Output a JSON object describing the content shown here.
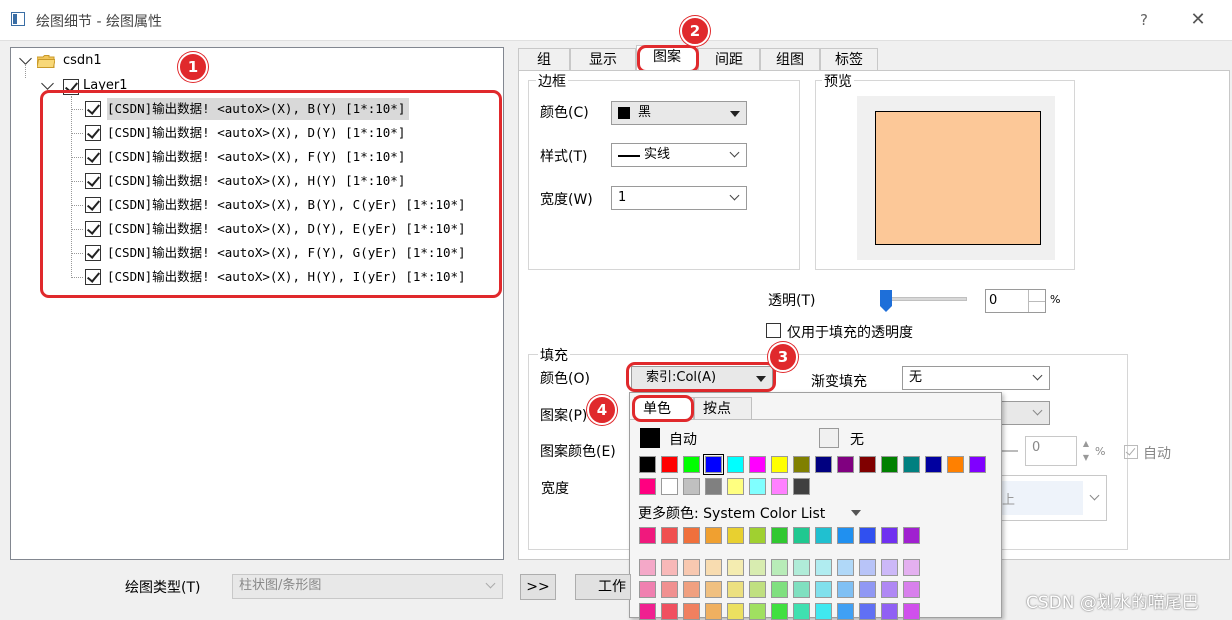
{
  "window": {
    "title": "绘图细节 - 绘图属性",
    "help_label": "?",
    "close_label": "✕"
  },
  "tree": {
    "root_label": "csdn1",
    "layer_label": "Layer1",
    "plots": [
      "[CSDN]输出数据! <autoX>(X), B(Y) [1*:10*]",
      "[CSDN]输出数据! <autoX>(X), D(Y) [1*:10*]",
      "[CSDN]输出数据! <autoX>(X), F(Y) [1*:10*]",
      "[CSDN]输出数据! <autoX>(X), H(Y) [1*:10*]",
      "[CSDN]输出数据! <autoX>(X), B(Y), C(yEr) [1*:10*]",
      "[CSDN]输出数据! <autoX>(X), D(Y), E(yEr) [1*:10*]",
      "[CSDN]输出数据! <autoX>(X), F(Y), G(yEr) [1*:10*]",
      "[CSDN]输出数据! <autoX>(X), H(Y), I(yEr) [1*:10*]"
    ]
  },
  "badges": [
    "1",
    "2",
    "3",
    "4"
  ],
  "tabs": [
    "组",
    "显示",
    "图案",
    "间距",
    "组图",
    "标签"
  ],
  "border_group": {
    "legend": "边框",
    "color_label": "颜色(C)",
    "color_value": "黑",
    "style_label": "样式(T)",
    "style_value": "实线",
    "width_label": "宽度(W)",
    "width_value": "1"
  },
  "preview": {
    "legend": "预览",
    "fill_color": "#fcc898"
  },
  "transparency": {
    "label": "透明(T)",
    "value": "0",
    "unit": "%",
    "fill_only_label": "仅用于填充的透明度"
  },
  "fill_group": {
    "legend": "填充",
    "color_label": "颜色(O)",
    "color_value": "索引:Col(A)",
    "gradient_label": "渐变填充",
    "gradient_value": "无",
    "pattern_label": "图案(P)",
    "pattern_color_label": "图案颜色(E)",
    "width_label": "宽度",
    "spin_value": "0",
    "spin_unit": "%",
    "auto_label": "自动",
    "behind_text": "上"
  },
  "color_popup": {
    "tabs": [
      "单色",
      "按点"
    ],
    "auto_label": "自动",
    "none_label": "无",
    "more_colors_label": "更多颜色: System Color List",
    "basic_colors": [
      "#000000",
      "#ff0000",
      "#00ff00",
      "#0000ff",
      "#00ffff",
      "#ff00ff",
      "#ffff00",
      "#808000",
      "#000080",
      "#800080",
      "#800000",
      "#008000",
      "#008080",
      "#0000a0",
      "#ff8000",
      "#8000ff"
    ],
    "row2_colors": [
      "#ff0080",
      "#ffffff",
      "#c0c0c0",
      "#808080",
      "#ffff80",
      "#80ffff",
      "#ff80ff",
      "#404040"
    ],
    "system_colors": [
      "#f0197d",
      "#f05050",
      "#f0703c",
      "#f0a030",
      "#e8d030",
      "#a0d030",
      "#30c830",
      "#20c890",
      "#20c0d0",
      "#2090f0",
      "#3050f0",
      "#7030f0",
      "#a020d0"
    ],
    "tint_rows": [
      [
        "#f4a8c8",
        "#f8b8b8",
        "#f8c8b0",
        "#f8dcb0",
        "#f4ecb0",
        "#d8ecb0",
        "#b8ecb8",
        "#b0ecd8",
        "#b0ecf0",
        "#b0d8f8",
        "#b8c4f8",
        "#ccb8f8",
        "#e4b0f0"
      ],
      [
        "#f080b0",
        "#f09090",
        "#f0a080",
        "#f0c080",
        "#ece080",
        "#c0e080",
        "#80e080",
        "#80e0c0",
        "#80e0ec",
        "#80c0f4",
        "#9098f4",
        "#b088f4",
        "#d880ec"
      ],
      [
        "#f02090",
        "#f05060",
        "#f08060",
        "#f0b060",
        "#ece060",
        "#a0e060",
        "#40e040",
        "#40e0b0",
        "#40e8f0",
        "#40a0f4",
        "#6070f4",
        "#9060f4",
        "#d050ec"
      ]
    ]
  },
  "bottom": {
    "plot_type_label": "绘图类型(T)",
    "plot_type_value": "柱状图/条形图",
    "expand_button": ">>",
    "workbook_button": "工作"
  },
  "watermark": "CSDN @划水的喵尾巴"
}
